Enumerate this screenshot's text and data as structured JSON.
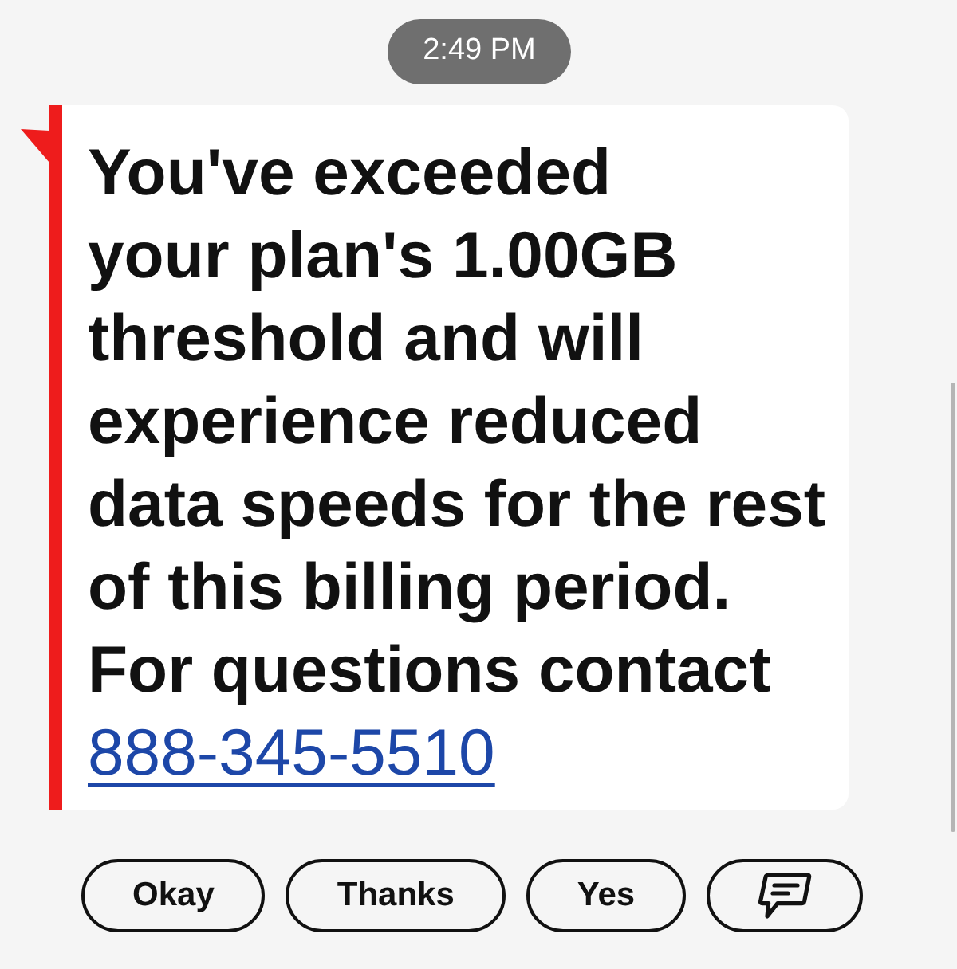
{
  "timestamp": "2:49 PM",
  "message": {
    "text": "You've exceeded\nyour plan's 1.00GB threshold and will experience reduced data speeds for the rest of this billing period. For questions contact",
    "link": "888-345-5510"
  },
  "quick_replies": [
    {
      "kind": "text",
      "label": "Okay"
    },
    {
      "kind": "text",
      "label": "Thanks"
    },
    {
      "kind": "text",
      "label": "Yes"
    },
    {
      "kind": "icon"
    }
  ]
}
